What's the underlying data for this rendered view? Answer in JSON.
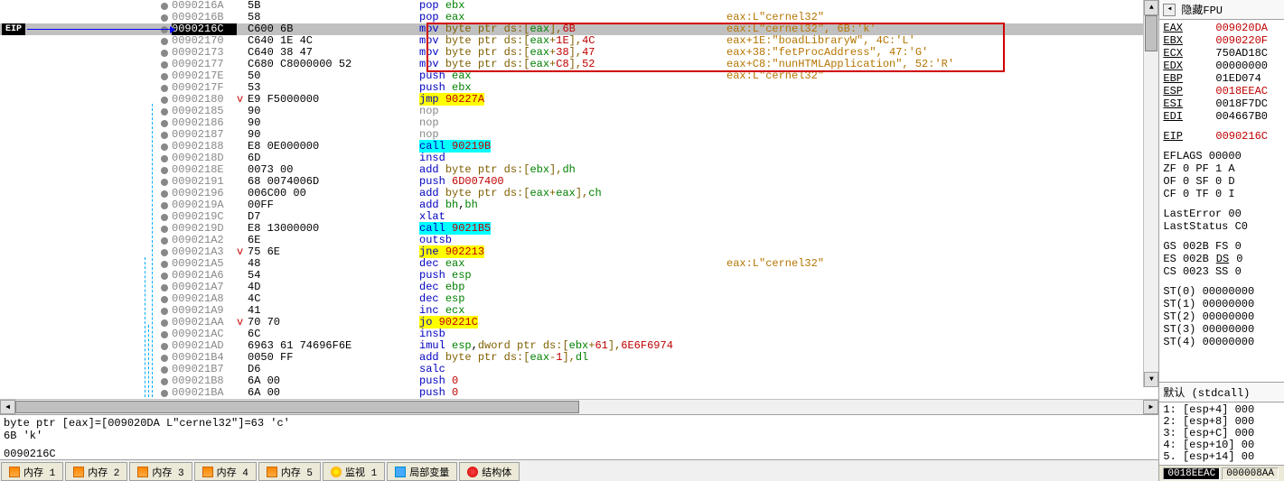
{
  "eip_label": "EIP",
  "rows": [
    {
      "addr": "0090216A",
      "bytes": "5B",
      "asm": [
        {
          "t": "pop ",
          "c": "blue"
        },
        {
          "t": "ebx",
          "c": "green"
        }
      ]
    },
    {
      "addr": "0090216B",
      "bytes": "58",
      "asm": [
        {
          "t": "pop ",
          "c": "blue"
        },
        {
          "t": "eax",
          "c": "green"
        }
      ],
      "cmt": "eax:L\"cernel32\""
    },
    {
      "addr": "0090216C",
      "bytes": "C600 6B",
      "hl": true,
      "active": true,
      "asm": [
        {
          "t": "mov ",
          "c": "blue"
        },
        {
          "t": "byte ptr ",
          "c": "brown"
        },
        {
          "t": "ds",
          "c": "brown"
        },
        {
          "t": ":[",
          "c": "brown"
        },
        {
          "t": "eax",
          "c": "green"
        },
        {
          "t": "],",
          "c": "brown"
        },
        {
          "t": "6B",
          "c": "red"
        }
      ],
      "cmt": "eax:L\"cernel32\", 6B:'k'"
    },
    {
      "addr": "00902170",
      "bytes": "C640 1E 4C",
      "asm": [
        {
          "t": "mov ",
          "c": "blue"
        },
        {
          "t": "byte ptr ",
          "c": "brown"
        },
        {
          "t": "ds",
          "c": "brown"
        },
        {
          "t": ":[",
          "c": "brown"
        },
        {
          "t": "eax",
          "c": "green"
        },
        {
          "t": "+",
          "c": "brown"
        },
        {
          "t": "1E",
          "c": "red"
        },
        {
          "t": "],",
          "c": "brown"
        },
        {
          "t": "4C",
          "c": "red"
        }
      ],
      "cmt": "eax+1E:\"boadLibraryW\", 4C:'L'"
    },
    {
      "addr": "00902173",
      "bytes": "C640 38 47",
      "asm": [
        {
          "t": "mov ",
          "c": "blue"
        },
        {
          "t": "byte ptr ",
          "c": "brown"
        },
        {
          "t": "ds",
          "c": "brown"
        },
        {
          "t": ":[",
          "c": "brown"
        },
        {
          "t": "eax",
          "c": "green"
        },
        {
          "t": "+",
          "c": "brown"
        },
        {
          "t": "38",
          "c": "red"
        },
        {
          "t": "],",
          "c": "brown"
        },
        {
          "t": "47",
          "c": "red"
        }
      ],
      "cmt": "eax+38:\"fetProcAddress\", 47:'G'"
    },
    {
      "addr": "00902177",
      "bytes": "C680 C8000000 52",
      "asm": [
        {
          "t": "mov ",
          "c": "blue"
        },
        {
          "t": "byte ptr ",
          "c": "brown"
        },
        {
          "t": "ds",
          "c": "brown"
        },
        {
          "t": ":[",
          "c": "brown"
        },
        {
          "t": "eax",
          "c": "green"
        },
        {
          "t": "+",
          "c": "brown"
        },
        {
          "t": "C8",
          "c": "red"
        },
        {
          "t": "],",
          "c": "brown"
        },
        {
          "t": "52",
          "c": "red"
        }
      ],
      "cmt": "eax+C8:\"nunHTMLApplication\", 52:'R'"
    },
    {
      "addr": "0090217E",
      "bytes": "50",
      "asm": [
        {
          "t": "push ",
          "c": "blue"
        },
        {
          "t": "eax",
          "c": "green"
        }
      ],
      "cmt": "eax:L\"cernel32\""
    },
    {
      "addr": "0090217F",
      "bytes": "53",
      "asm": [
        {
          "t": "push ",
          "c": "blue"
        },
        {
          "t": "ebx",
          "c": "green"
        }
      ]
    },
    {
      "addr": "00902180",
      "bytes": "E9 F5000000",
      "mark": "v",
      "asm": [
        {
          "t": "jmp ",
          "c": "blue",
          "h": "yellow"
        },
        {
          "t": "90227A",
          "c": "red",
          "h": "yellow"
        }
      ]
    },
    {
      "addr": "00902185",
      "bytes": "90",
      "asm": [
        {
          "t": "nop",
          "c": "gray"
        }
      ]
    },
    {
      "addr": "00902186",
      "bytes": "90",
      "asm": [
        {
          "t": "nop",
          "c": "gray"
        }
      ]
    },
    {
      "addr": "00902187",
      "bytes": "90",
      "asm": [
        {
          "t": "nop",
          "c": "gray"
        }
      ]
    },
    {
      "addr": "00902188",
      "bytes": "E8 0E000000",
      "asm": [
        {
          "t": "call ",
          "c": "blue",
          "h": "cyan"
        },
        {
          "t": "90219B",
          "c": "red",
          "h": "cyan"
        }
      ]
    },
    {
      "addr": "0090218D",
      "bytes": "6D",
      "asm": [
        {
          "t": "insd",
          "c": "blue"
        }
      ]
    },
    {
      "addr": "0090218E",
      "bytes": "0073 00",
      "asm": [
        {
          "t": "add ",
          "c": "blue"
        },
        {
          "t": "byte ptr ",
          "c": "brown"
        },
        {
          "t": "ds",
          "c": "brown"
        },
        {
          "t": ":[",
          "c": "brown"
        },
        {
          "t": "ebx",
          "c": "green"
        },
        {
          "t": "],",
          "c": "brown"
        },
        {
          "t": "dh",
          "c": "green"
        }
      ]
    },
    {
      "addr": "00902191",
      "bytes": "68 0074006D",
      "asm": [
        {
          "t": "push ",
          "c": "blue"
        },
        {
          "t": "6D007400",
          "c": "red"
        }
      ]
    },
    {
      "addr": "00902196",
      "bytes": "006C00 00",
      "asm": [
        {
          "t": "add ",
          "c": "blue"
        },
        {
          "t": "byte ptr ",
          "c": "brown"
        },
        {
          "t": "ds",
          "c": "brown"
        },
        {
          "t": ":[",
          "c": "brown"
        },
        {
          "t": "eax",
          "c": "green"
        },
        {
          "t": "+",
          "c": "brown"
        },
        {
          "t": "eax",
          "c": "green"
        },
        {
          "t": "],",
          "c": "brown"
        },
        {
          "t": "ch",
          "c": "green"
        }
      ]
    },
    {
      "addr": "0090219A",
      "bytes": "00FF",
      "asm": [
        {
          "t": "add ",
          "c": "blue"
        },
        {
          "t": "bh",
          "c": "green"
        },
        {
          "t": ",",
          "c": ""
        },
        {
          "t": "bh",
          "c": "green"
        }
      ]
    },
    {
      "addr": "0090219C",
      "bytes": "D7",
      "asm": [
        {
          "t": "xlat",
          "c": "blue"
        }
      ]
    },
    {
      "addr": "0090219D",
      "bytes": "E8 13000000",
      "asm": [
        {
          "t": "call ",
          "c": "blue",
          "h": "cyan"
        },
        {
          "t": "9021B5",
          "c": "red",
          "h": "cyan"
        }
      ]
    },
    {
      "addr": "009021A2",
      "bytes": "6E",
      "asm": [
        {
          "t": "outsb",
          "c": "blue"
        }
      ]
    },
    {
      "addr": "009021A3",
      "bytes": "75 6E",
      "mark": "v",
      "asm": [
        {
          "t": "jne ",
          "c": "blue",
          "h": "yellow"
        },
        {
          "t": "902213",
          "c": "red",
          "h": "yellow"
        }
      ]
    },
    {
      "addr": "009021A5",
      "bytes": "48",
      "asm": [
        {
          "t": "dec ",
          "c": "blue"
        },
        {
          "t": "eax",
          "c": "green"
        }
      ],
      "cmt": "eax:L\"cernel32\""
    },
    {
      "addr": "009021A6",
      "bytes": "54",
      "asm": [
        {
          "t": "push ",
          "c": "blue"
        },
        {
          "t": "esp",
          "c": "green"
        }
      ]
    },
    {
      "addr": "009021A7",
      "bytes": "4D",
      "asm": [
        {
          "t": "dec ",
          "c": "blue"
        },
        {
          "t": "ebp",
          "c": "green"
        }
      ]
    },
    {
      "addr": "009021A8",
      "bytes": "4C",
      "asm": [
        {
          "t": "dec ",
          "c": "blue"
        },
        {
          "t": "esp",
          "c": "green"
        }
      ]
    },
    {
      "addr": "009021A9",
      "bytes": "41",
      "asm": [
        {
          "t": "inc ",
          "c": "blue"
        },
        {
          "t": "ecx",
          "c": "green"
        }
      ]
    },
    {
      "addr": "009021AA",
      "bytes": "70 70",
      "mark": "v",
      "asm": [
        {
          "t": "jo ",
          "c": "blue",
          "h": "yellow"
        },
        {
          "t": "90221C",
          "c": "red",
          "h": "yellow"
        }
      ]
    },
    {
      "addr": "009021AC",
      "bytes": "6C",
      "asm": [
        {
          "t": "insb",
          "c": "blue"
        }
      ]
    },
    {
      "addr": "009021AD",
      "bytes": "6963 61 74696F6E",
      "asm": [
        {
          "t": "imul ",
          "c": "blue"
        },
        {
          "t": "esp",
          "c": "green"
        },
        {
          "t": ",",
          "c": ""
        },
        {
          "t": "dword ptr ",
          "c": "brown"
        },
        {
          "t": "ds",
          "c": "brown"
        },
        {
          "t": ":[",
          "c": "brown"
        },
        {
          "t": "ebx",
          "c": "green"
        },
        {
          "t": "+",
          "c": "brown"
        },
        {
          "t": "61",
          "c": "red"
        },
        {
          "t": "],",
          "c": "brown"
        },
        {
          "t": "6E6F6974",
          "c": "red"
        }
      ]
    },
    {
      "addr": "009021B4",
      "bytes": "0050 FF",
      "asm": [
        {
          "t": "add ",
          "c": "blue"
        },
        {
          "t": "byte ptr ",
          "c": "brown"
        },
        {
          "t": "ds",
          "c": "brown"
        },
        {
          "t": ":[",
          "c": "brown"
        },
        {
          "t": "eax",
          "c": "green"
        },
        {
          "t": "-",
          "c": "brown"
        },
        {
          "t": "1",
          "c": "red"
        },
        {
          "t": "],",
          "c": "brown"
        },
        {
          "t": "dl",
          "c": "green"
        }
      ]
    },
    {
      "addr": "009021B7",
      "bytes": "D6",
      "asm": [
        {
          "t": "salc",
          "c": "blue"
        }
      ]
    },
    {
      "addr": "009021B8",
      "bytes": "6A 00",
      "asm": [
        {
          "t": "push ",
          "c": "blue"
        },
        {
          "t": "0",
          "c": "red"
        }
      ]
    },
    {
      "addr": "009021BA",
      "bytes": "6A 00",
      "asm": [
        {
          "t": "push ",
          "c": "blue"
        },
        {
          "t": "0",
          "c": "red"
        }
      ]
    }
  ],
  "info": {
    "l1": "byte ptr [eax]=[009020DA L\"cernel32\"]=63 'c'",
    "l2": "6B 'k'",
    "l3": "0090216C"
  },
  "tabs": [
    {
      "label": "内存 1",
      "ico": "mem"
    },
    {
      "label": "内存 2",
      "ico": "mem"
    },
    {
      "label": "内存 3",
      "ico": "mem"
    },
    {
      "label": "内存 4",
      "ico": "mem"
    },
    {
      "label": "内存 5",
      "ico": "mem"
    },
    {
      "label": "监视 1",
      "ico": "watch"
    },
    {
      "label": "局部变量",
      "ico": "var"
    },
    {
      "label": "结构体",
      "ico": "struct"
    }
  ],
  "reg_header": {
    "btn": "隐藏FPU",
    "x": "◂"
  },
  "regs": [
    {
      "n": "EAX",
      "v": "009020DA",
      "red": true
    },
    {
      "n": "EBX",
      "v": "0090220F",
      "red": true
    },
    {
      "n": "ECX",
      "v": "750AD18C"
    },
    {
      "n": "EDX",
      "v": "00000000"
    },
    {
      "n": "EBP",
      "v": "01ED074"
    },
    {
      "n": "ESP",
      "v": "0018EEAC",
      "red": true
    },
    {
      "n": "ESI",
      "v": "0018F7DC"
    },
    {
      "n": "EDI",
      "v": "004667B0"
    }
  ],
  "eip": {
    "n": "EIP",
    "v": "0090216C"
  },
  "eflags": {
    "label": "EFLAGS",
    "val": "00000"
  },
  "flags": [
    {
      "l": "ZF 0  PF 1  A"
    },
    {
      "l": "OF 0  SF 0  D"
    },
    {
      "l": "CF 0  TF 0  I"
    }
  ],
  "errors": [
    {
      "l": "LastError  00"
    },
    {
      "l": "LastStatus C0"
    }
  ],
  "segs": [
    {
      "l": "GS 002B  FS 0"
    },
    {
      "l": "ES 002B  DS 0"
    },
    {
      "l": "CS 0023  SS 0"
    }
  ],
  "fpu": [
    {
      "l": "ST(0) 00000000"
    },
    {
      "l": "ST(1) 00000000"
    },
    {
      "l": "ST(2) 00000000"
    },
    {
      "l": "ST(3) 00000000"
    },
    {
      "l": "ST(4) 00000000"
    }
  ],
  "stack_header": "默认 (stdcall)",
  "stack": [
    {
      "l": "1: [esp+4] 000"
    },
    {
      "l": "2: [esp+8] 000"
    },
    {
      "l": "3: [esp+C] 000"
    },
    {
      "l": "4: [esp+10] 00"
    },
    {
      "l": "5. [esp+14] 00"
    }
  ],
  "status": {
    "addr": "0018EEAC",
    "val": "000008AA"
  }
}
